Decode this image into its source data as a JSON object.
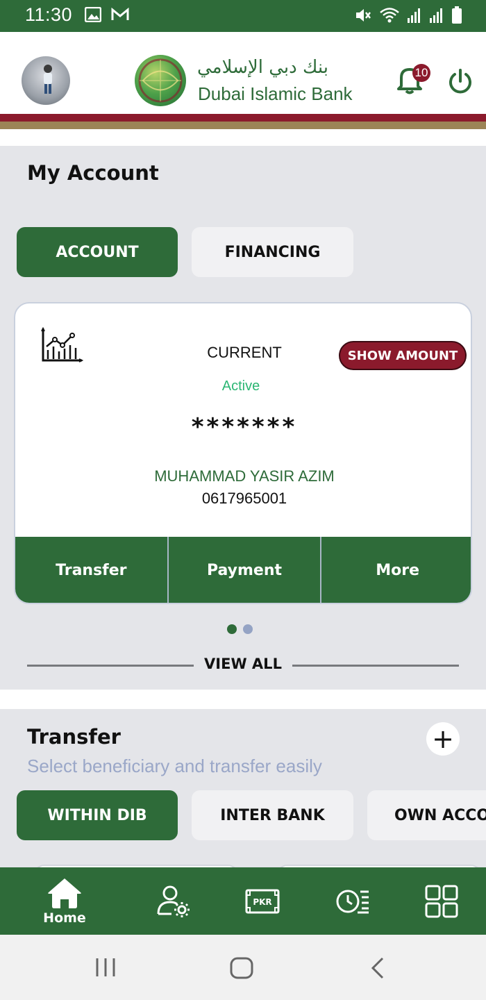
{
  "status_bar": {
    "time": "11:30",
    "left_icons": [
      "image-icon",
      "gmail-icon"
    ],
    "right_icons": [
      "mute-icon",
      "wifi-icon",
      "signal-icon",
      "signal-roaming-icon",
      "battery-icon"
    ]
  },
  "header": {
    "logo_arabic": "بنك دبي الإسلامي",
    "logo_english": "Dubai Islamic Bank",
    "notification_count": "10"
  },
  "my_account": {
    "title": "My Account",
    "tabs": [
      {
        "label": "ACCOUNT",
        "active": true
      },
      {
        "label": "FINANCING",
        "active": false
      }
    ],
    "card": {
      "type": "CURRENT",
      "status": "Active",
      "show_amount_label": "SHOW AMOUNT",
      "masked_balance": "*******",
      "holder_name": "MUHAMMAD YASIR AZIM",
      "account_number": "0617965001",
      "actions": [
        "Transfer",
        "Payment",
        "More"
      ]
    },
    "pager": {
      "count": 2,
      "active_index": 0
    },
    "view_all_label": "VIEW ALL"
  },
  "transfer": {
    "title": "Transfer",
    "subtitle": "Select beneficiary and transfer easily",
    "add_label": "+",
    "tabs": [
      {
        "label": "WITHIN DIB",
        "active": true
      },
      {
        "label": "INTER BANK",
        "active": false
      },
      {
        "label": "OWN ACCO",
        "active": false
      }
    ]
  },
  "bottom_nav": {
    "home_label": "Home",
    "pkr_label": "PKR"
  },
  "colors": {
    "brand_green": "#2e6b39",
    "maroon": "#8b1a2c",
    "gold": "#9c8456",
    "active_green": "#2bb673"
  }
}
